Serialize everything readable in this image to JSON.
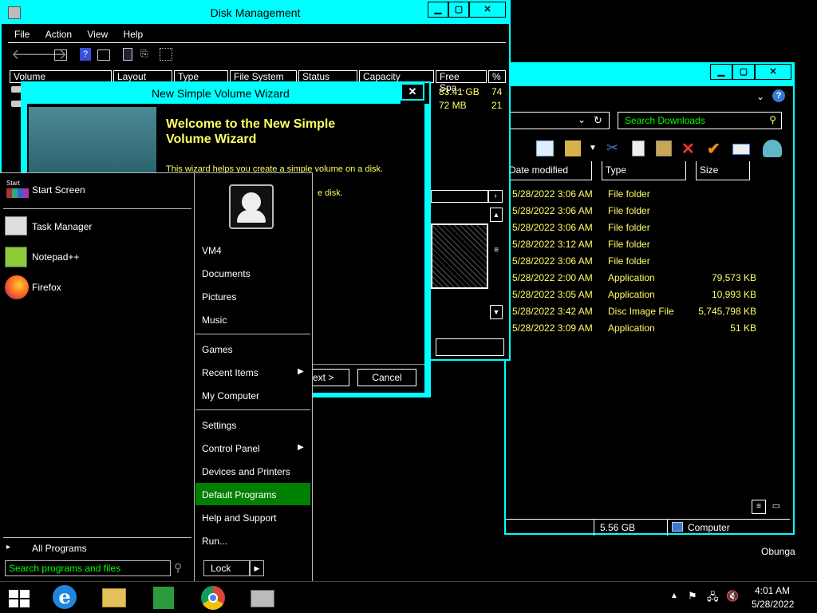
{
  "disk_mgmt": {
    "title": "Disk Management",
    "menu": [
      "File",
      "Action",
      "View",
      "Help"
    ],
    "columns": [
      "Volume",
      "Layout",
      "Type",
      "File System",
      "Status",
      "Capacity",
      "Free Spa...",
      "% F"
    ],
    "rows": [
      {
        "free": "83.41 GB",
        "pct": "74"
      },
      {
        "free": "72 MB",
        "pct": "21"
      }
    ]
  },
  "explorer": {
    "search_placeholder": "Search Downloads",
    "columns": [
      "Date modified",
      "Type",
      "Size"
    ],
    "files": [
      {
        "date": "5/28/2022 3:06 AM",
        "type": "File folder",
        "size": ""
      },
      {
        "date": "5/28/2022 3:06 AM",
        "type": "File folder",
        "size": ""
      },
      {
        "date": "5/28/2022 3:06 AM",
        "type": "File folder",
        "size": ""
      },
      {
        "date": "5/28/2022 3:12 AM",
        "type": "File folder",
        "size": ""
      },
      {
        "date": "5/28/2022 3:06 AM",
        "type": "File folder",
        "size": ""
      },
      {
        "date": "5/28/2022 2:00 AM",
        "type": "Application",
        "size": "79,573 KB"
      },
      {
        "date": "5/28/2022 3:05 AM",
        "type": "Application",
        "size": "10,993 KB"
      },
      {
        "date": "5/28/2022 3:42 AM",
        "type": "Disc Image File",
        "size": "5,745,798 KB"
      },
      {
        "date": "5/28/2022 3:09 AM",
        "type": "Application",
        "size": "51 KB"
      }
    ],
    "status_size": "5.56 GB",
    "status_location": "Computer"
  },
  "wizard": {
    "title": "New Simple Volume Wizard",
    "heading": "Welcome to the New Simple Volume Wizard",
    "line1": "This wizard helps you create a simple volume on a disk.",
    "line2_tail": "e disk.",
    "next_label": "ext >",
    "cancel_label": "Cancel"
  },
  "start_menu": {
    "start_screen_tiny": "Start",
    "start_screen": "Start Screen",
    "pinned": [
      "Task Manager",
      "Notepad++",
      "Firefox"
    ],
    "all_programs": "All Programs",
    "search_placeholder": "Search programs and files",
    "user": "VM4",
    "right_items_1": [
      "Documents",
      "Pictures",
      "Music"
    ],
    "right_items_2": [
      "Games",
      "Recent Items",
      "My Computer"
    ],
    "right_items_3": [
      "Settings",
      "Control Panel",
      "Devices and Printers",
      "Default Programs",
      "Help and Support",
      "Run..."
    ],
    "lock_label": "Lock"
  },
  "desktop": {
    "username_label": "Obunga"
  },
  "taskbar": {
    "time": "4:01 AM",
    "date": "5/28/2022"
  },
  "colors": {
    "accent": "#00ffff",
    "highlight": "#008000",
    "text_yellow": "#ffff66",
    "link_green": "#00ff00"
  }
}
